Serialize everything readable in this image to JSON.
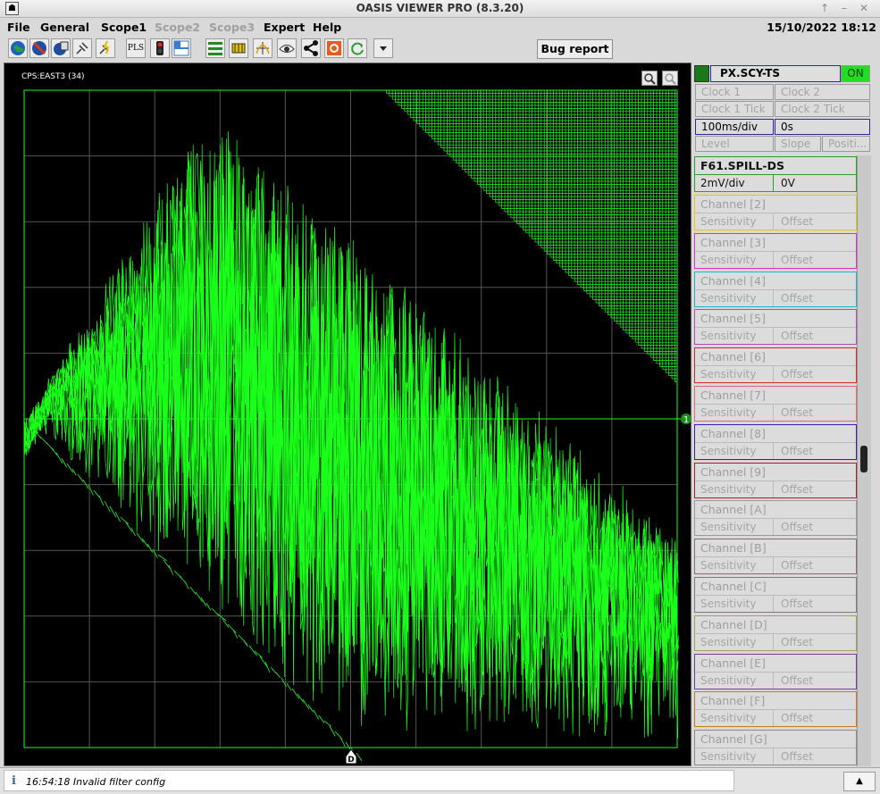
{
  "window": {
    "title": "OASIS VIEWER PRO (8.3.20)",
    "datetime": "15/10/2022 18:12"
  },
  "menu": {
    "file": "File",
    "general": "General",
    "scope1": "Scope1",
    "scope2": "Scope2",
    "scope3": "Scope3",
    "expert": "Expert",
    "help": "Help"
  },
  "toolbar": {
    "pls_label": "PLS",
    "bug_report": "Bug report",
    "icons": [
      "globe-icon",
      "ban-icon",
      "save-icon",
      "plug-icon",
      "plug-lightning-icon",
      "pls-button",
      "traffic-light-icon",
      "layout-icon",
      "lines-icon",
      "chip-icon",
      "chart-icon",
      "eye-icon",
      "share-icon",
      "record-icon",
      "refresh-icon",
      "dropdown-icon"
    ]
  },
  "plot": {
    "title": "CPS:EAST3 (34)",
    "channel_marker": "1",
    "trigger_marker": "D",
    "trace_color": "#1aff1a"
  },
  "trigger": {
    "name": "PX.SCY-TS",
    "state": "ON",
    "clock1": "Clock 1",
    "clock2": "Clock 2",
    "clock1_tick": "Clock 1 Tick",
    "clock2_tick": "Clock 2 Tick",
    "timebase": "100ms/div",
    "delay": "0s",
    "level": "Level",
    "slope": "Slope",
    "position": "Positi..."
  },
  "channel1": {
    "name": "F61.SPILL-DS",
    "sensitivity": "2mV/div",
    "offset": "0V"
  },
  "channels": [
    {
      "name": "Channel [2]",
      "sensitivity": "Sensitivity",
      "offset": "Offset",
      "color": "#e8c800"
    },
    {
      "name": "Channel [3]",
      "sensitivity": "Sensitivity",
      "offset": "Offset",
      "color": "#e02bd0"
    },
    {
      "name": "Channel [4]",
      "sensitivity": "Sensitivity",
      "offset": "Offset",
      "color": "#1ab6c8"
    },
    {
      "name": "Channel [5]",
      "sensitivity": "Sensitivity",
      "offset": "Offset",
      "color": "#b24ab0"
    },
    {
      "name": "Channel [6]",
      "sensitivity": "Sensitivity",
      "offset": "Offset",
      "color": "#d42424"
    },
    {
      "name": "Channel [7]",
      "sensitivity": "Sensitivity",
      "offset": "Offset",
      "color": "#e06868"
    },
    {
      "name": "Channel [8]",
      "sensitivity": "Sensitivity",
      "offset": "Offset",
      "color": "#3a1ab0"
    },
    {
      "name": "Channel [9]",
      "sensitivity": "Sensitivity",
      "offset": "Offset",
      "color": "#b01a1a"
    },
    {
      "name": "Channel [A]",
      "sensitivity": "Sensitivity",
      "offset": "Offset",
      "color": "#9a9a9a"
    },
    {
      "name": "Channel [B]",
      "sensitivity": "Sensitivity",
      "offset": "Offset",
      "color": "#8a6a6a"
    },
    {
      "name": "Channel [C]",
      "sensitivity": "Sensitivity",
      "offset": "Offset",
      "color": "#7a7a7a"
    },
    {
      "name": "Channel [D]",
      "sensitivity": "Sensitivity",
      "offset": "Offset",
      "color": "#a0a060"
    },
    {
      "name": "Channel [E]",
      "sensitivity": "Sensitivity",
      "offset": "Offset",
      "color": "#7a3a9a"
    },
    {
      "name": "Channel [F]",
      "sensitivity": "Sensitivity",
      "offset": "Offset",
      "color": "#c87a1a"
    },
    {
      "name": "Channel [G]",
      "sensitivity": "Sensitivity",
      "offset": "Offset",
      "color": "#8a8a8a"
    }
  ],
  "status": {
    "info_glyph": "i",
    "message": "16:54:18 Invalid filter config"
  }
}
